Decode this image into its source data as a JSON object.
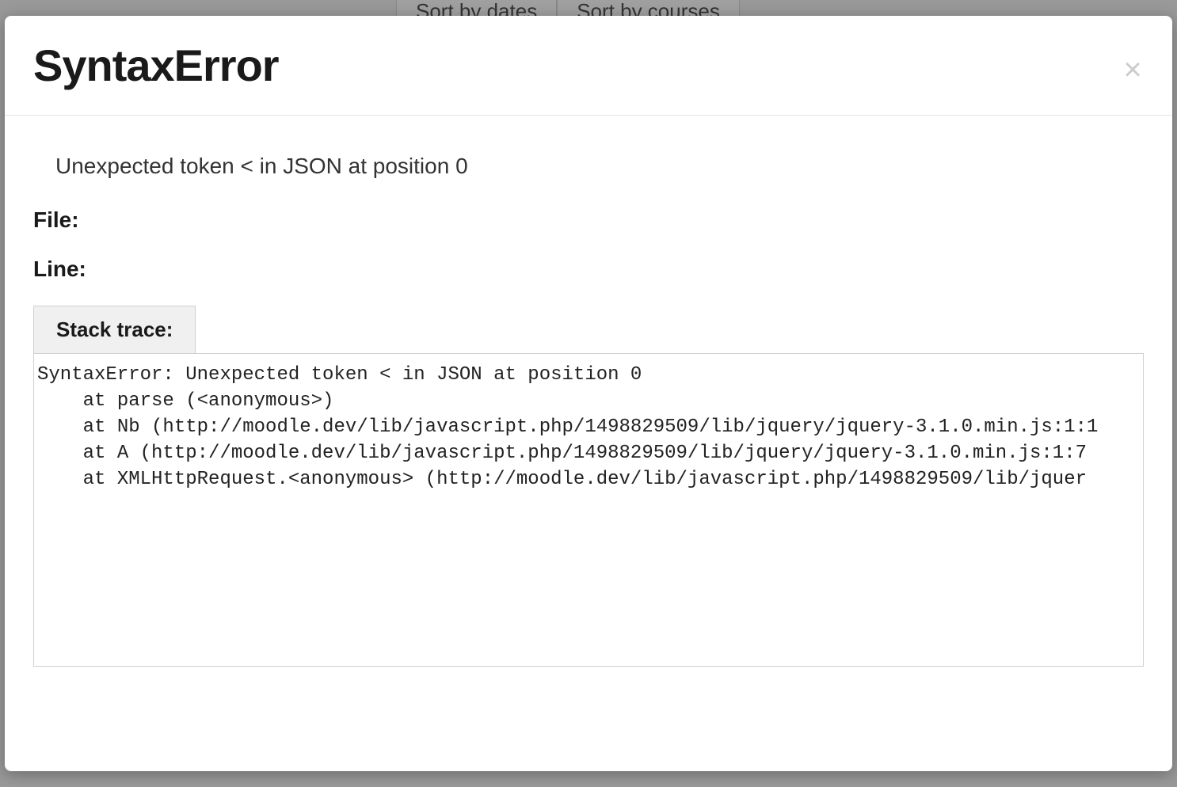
{
  "background": {
    "tabs": [
      {
        "label": "Sort by dates"
      },
      {
        "label": "Sort by courses"
      }
    ]
  },
  "modal": {
    "title": "SyntaxError",
    "close_label": "×",
    "message": "Unexpected token < in JSON at position 0",
    "file_label": "File:",
    "file_value": "",
    "line_label": "Line:",
    "line_value": "",
    "stack_tab_label": "Stack trace:",
    "stack_trace": "SyntaxError: Unexpected token < in JSON at position 0\n    at parse (<anonymous>)\n    at Nb (http://moodle.dev/lib/javascript.php/1498829509/lib/jquery/jquery-3.1.0.min.js:1:1\n    at A (http://moodle.dev/lib/javascript.php/1498829509/lib/jquery/jquery-3.1.0.min.js:1:7\n    at XMLHttpRequest.<anonymous> (http://moodle.dev/lib/javascript.php/1498829509/lib/jquer"
  }
}
